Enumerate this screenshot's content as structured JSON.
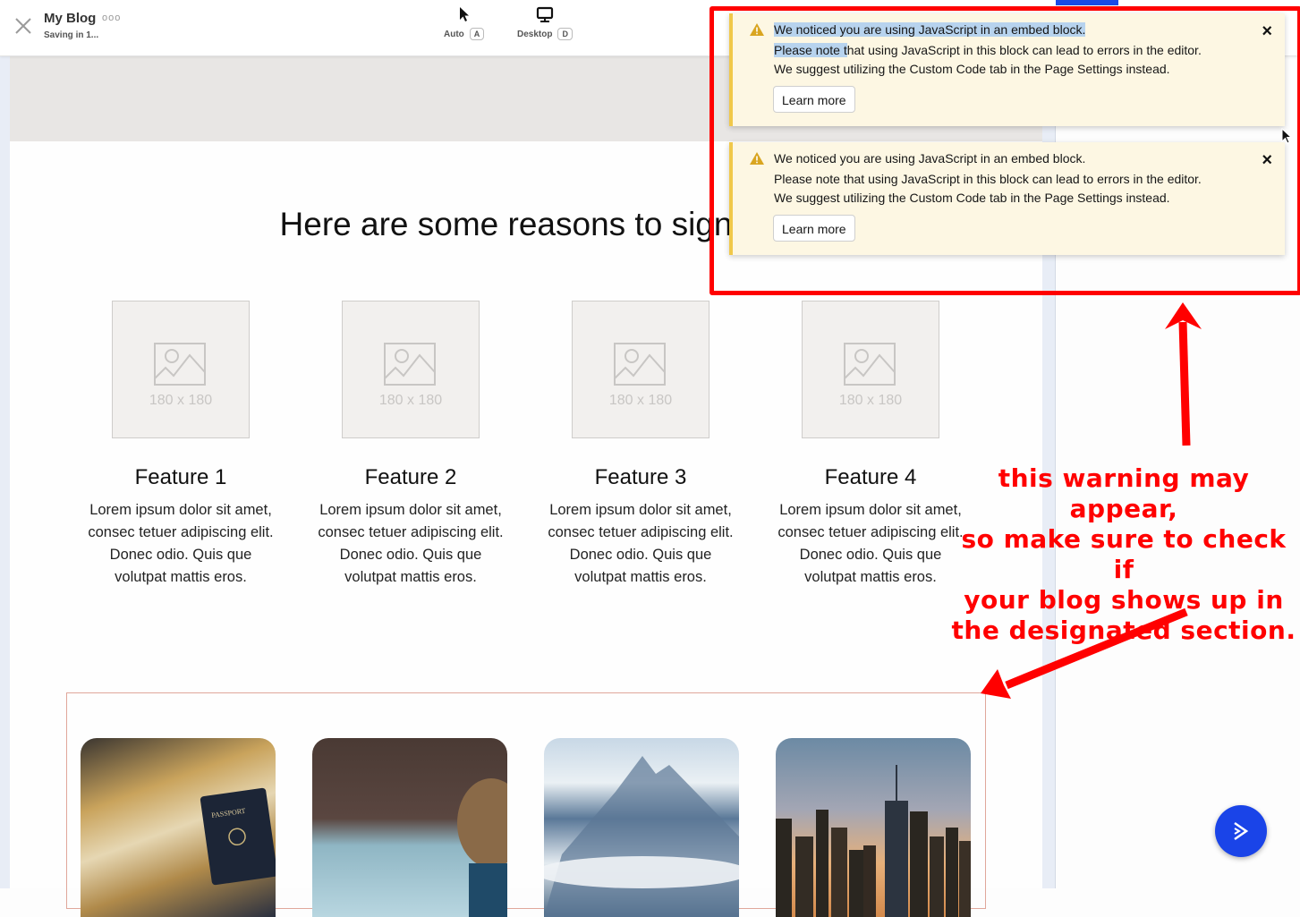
{
  "topbar": {
    "close_icon": "close-x-icon",
    "title": "My Blog",
    "more_icon": "ooo",
    "status": "Saving in 1...",
    "modes": [
      {
        "label": "Auto",
        "shortcut": "A",
        "icon": "pointer-cursor-icon"
      },
      {
        "label": "Desktop",
        "shortcut": "D",
        "icon": "desktop-monitor-icon"
      }
    ]
  },
  "canvas": {
    "section_title": "Here are some reasons to sign",
    "features": [
      {
        "placeholder": "180 x 180",
        "title": "Feature 1",
        "text": "Lorem ipsum dolor sit amet, consec tetuer adipiscing elit. Donec odio. Quis que volutpat mattis eros."
      },
      {
        "placeholder": "180 x 180",
        "title": "Feature 2",
        "text": "Lorem ipsum dolor sit amet, consec tetuer adipiscing elit. Donec odio. Quis que volutpat mattis eros."
      },
      {
        "placeholder": "180 x 180",
        "title": "Feature 3",
        "text": "Lorem ipsum dolor sit amet, consec tetuer adipiscing elit. Donec odio. Quis que volutpat mattis eros."
      },
      {
        "placeholder": "180 x 180",
        "title": "Feature 4",
        "text": "Lorem ipsum dolor sit amet, consec tetuer adipiscing elit. Donec odio. Quis que volutpat mattis eros."
      }
    ],
    "blog_cards": [
      {
        "image": "passport-on-world-map-photo"
      },
      {
        "image": "child-reading-map-photo"
      },
      {
        "image": "cloudy-mountain-peak-photo"
      },
      {
        "image": "city-skyline-sunset-photo"
      }
    ]
  },
  "notifications": [
    {
      "icon": "warning-triangle-icon",
      "title": "We noticed you are using JavaScript in an embed block.",
      "line2_highlighted": "Please note t",
      "line2_rest": "hat using JavaScript in this block can lead to errors in the editor.",
      "line2": "Please note that using JavaScript in this block can lead to errors in the editor.",
      "line3": "We suggest utilizing the Custom Code tab in the Page Settings instead.",
      "button": "Learn more",
      "close": "×",
      "highlighted": true
    },
    {
      "icon": "warning-triangle-icon",
      "title": "We noticed you are using JavaScript in an embed block.",
      "line2": "Please note that using JavaScript in this block can lead to errors in the editor.",
      "line3": "We suggest utilizing the Custom Code tab in the Page Settings instead.",
      "button": "Learn more",
      "close": "×",
      "highlighted": false
    }
  ],
  "annotation": {
    "text": "this warning may appear, so make sure to check if your blog shows up in the designated section.",
    "lines": [
      "this warning may appear,",
      "so make sure to check if",
      "your blog shows up in",
      "the designated section."
    ],
    "color": "#ff0000"
  },
  "colors": {
    "accent_blue": "#1a44e8",
    "toast_bg": "#fdf7e3",
    "toast_border": "#f0c84a",
    "annotation_red": "#ff0000",
    "blog_section_border": "#e0a79b"
  },
  "fab": {
    "icon": "chevron-right-double-icon"
  }
}
